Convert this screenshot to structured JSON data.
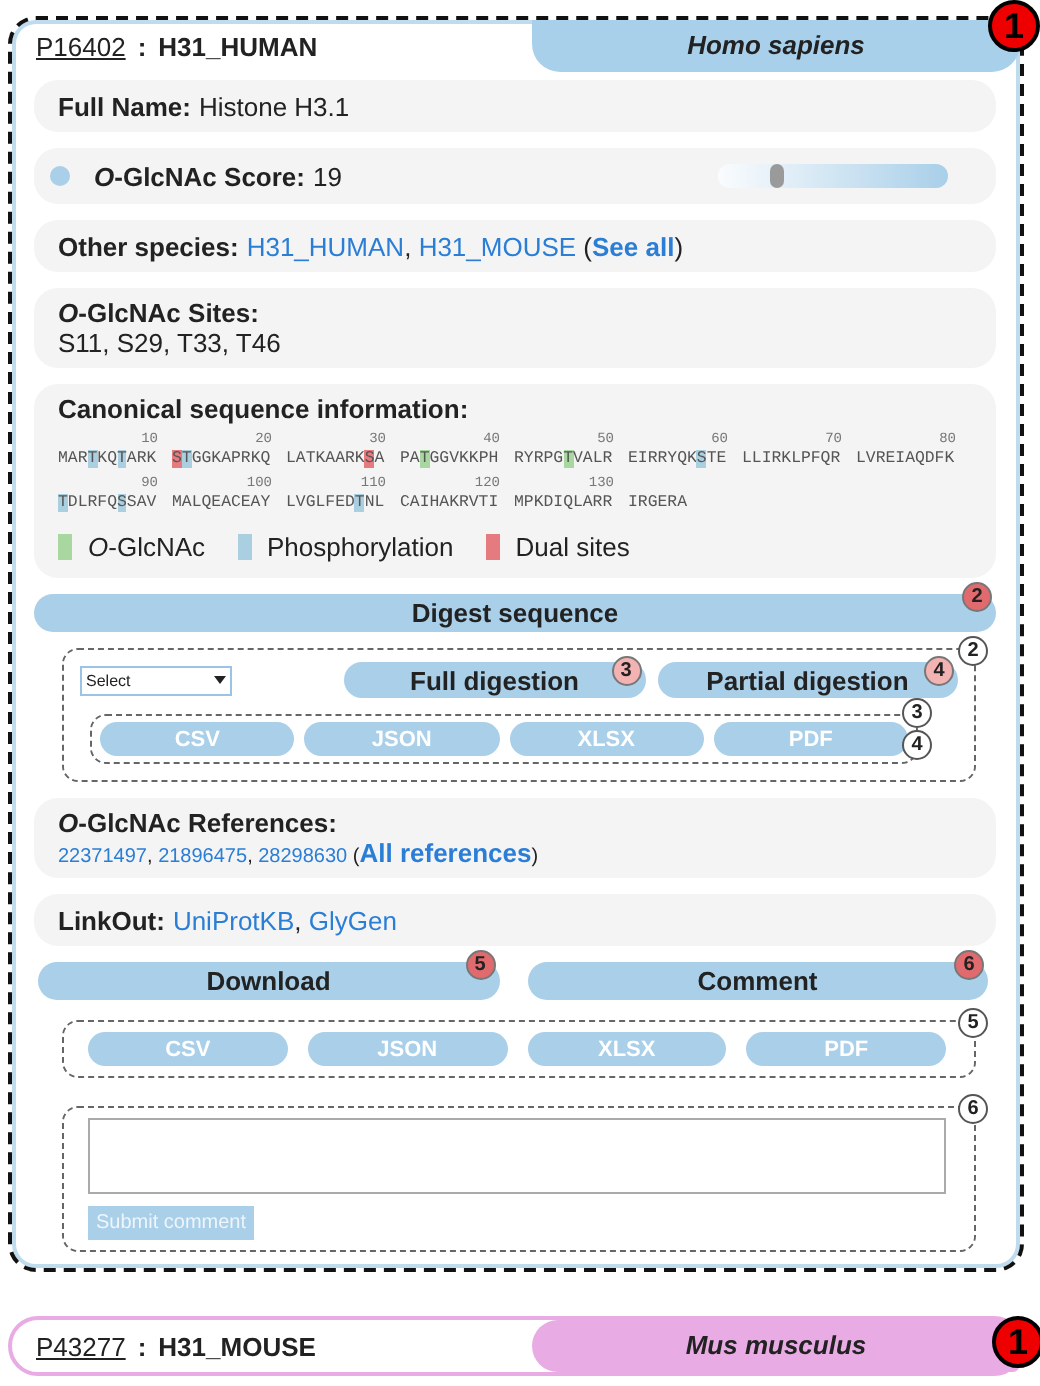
{
  "entries": [
    {
      "accession": "P16402",
      "name": "H31_HUMAN",
      "separator": ":",
      "species": "Homo sapiens",
      "color": "#a9d0ea",
      "badge": {
        "text": "1",
        "kind": "primary"
      },
      "expanded": true,
      "full_name": {
        "label": "Full Name:",
        "value": "Histone H3.1"
      },
      "score": {
        "label": "*O*-GlcNAc Score:",
        "value": "19",
        "level": 0.25
      },
      "other_species": {
        "label": "Other species:",
        "parts": [
          {
            "text": "H31_HUMAN",
            "kind": "link"
          },
          {
            "text": ", ",
            "kind": "plain"
          },
          {
            "text": "H31_MOUSE",
            "kind": "link"
          },
          {
            "text": " (",
            "kind": "plain"
          },
          {
            "text": "See all",
            "kind": "strong-link"
          },
          {
            "text": ")",
            "kind": "plain"
          }
        ]
      },
      "sites": {
        "label": "*O*-GlcNAc Sites:",
        "value": "S11, S29, T33, T46"
      },
      "sequence": {
        "title": "Canonical sequence information:",
        "lines": [
          [
            {
              "tick": "10",
              "segments": [
                {
                  "text": "MAR",
                  "kind": "plain"
                },
                {
                  "text": "T",
                  "kind": "phospho"
                },
                {
                  "text": "KQ",
                  "kind": "plain"
                },
                {
                  "text": "T",
                  "kind": "phospho"
                },
                {
                  "text": "ARK",
                  "kind": "plain"
                }
              ]
            },
            {
              "tick": "20",
              "segments": [
                {
                  "text": "S",
                  "kind": "dual"
                },
                {
                  "text": "T",
                  "kind": "phospho"
                },
                {
                  "text": "GGKAPRKQ",
                  "kind": "plain"
                }
              ]
            },
            {
              "tick": "30",
              "segments": [
                {
                  "text": "LATKAARK",
                  "kind": "plain"
                },
                {
                  "text": "S",
                  "kind": "dual"
                },
                {
                  "text": "A",
                  "kind": "plain"
                }
              ]
            },
            {
              "tick": "40",
              "segments": [
                {
                  "text": "PA",
                  "kind": "plain"
                },
                {
                  "text": "T",
                  "kind": "glcnac"
                },
                {
                  "text": "GGVKKPH",
                  "kind": "plain"
                }
              ]
            },
            {
              "tick": "50",
              "segments": [
                {
                  "text": "RYRPG",
                  "kind": "plain"
                },
                {
                  "text": "T",
                  "kind": "glcnac"
                },
                {
                  "text": "VALR",
                  "kind": "plain"
                }
              ]
            },
            {
              "tick": "60",
              "segments": [
                {
                  "text": "EIRRYQK",
                  "kind": "plain"
                },
                {
                  "text": "S",
                  "kind": "phospho"
                },
                {
                  "text": "TE",
                  "kind": "plain"
                }
              ]
            },
            {
              "tick": "70",
              "segments": [
                {
                  "text": "LLIRKLPFQR",
                  "kind": "plain"
                }
              ]
            },
            {
              "tick": "80",
              "segments": [
                {
                  "text": "LVREIAQDFK",
                  "kind": "plain"
                }
              ]
            }
          ],
          [
            {
              "tick": "90",
              "segments": [
                {
                  "text": "T",
                  "kind": "phospho"
                },
                {
                  "text": "DLRFQ",
                  "kind": "plain"
                },
                {
                  "text": "S",
                  "kind": "phospho"
                },
                {
                  "text": "SAV",
                  "kind": "plain"
                }
              ]
            },
            {
              "tick": "100",
              "segments": [
                {
                  "text": "MALQEACEAY",
                  "kind": "plain"
                }
              ]
            },
            {
              "tick": "110",
              "segments": [
                {
                  "text": "LVGLFED",
                  "kind": "plain"
                },
                {
                  "text": "T",
                  "kind": "phospho"
                },
                {
                  "text": "NL",
                  "kind": "plain"
                }
              ]
            },
            {
              "tick": "120",
              "segments": [
                {
                  "text": "CAIHAKRVTI",
                  "kind": "plain"
                }
              ]
            },
            {
              "tick": "130",
              "segments": [
                {
                  "text": "MPKDIQLARR",
                  "kind": "plain"
                }
              ]
            },
            {
              "segments": [
                {
                  "text": "IRGERA",
                  "kind": "plain"
                }
              ]
            }
          ]
        ],
        "legend": [
          {
            "label": "*O*-GlcNAc",
            "color": "#a8d8a0"
          },
          {
            "label": "Phosphorylation",
            "color": "#a9cfe0"
          },
          {
            "label": "Dual sites",
            "color": "#e57a7f"
          }
        ]
      },
      "digest": {
        "label": "Digest sequence",
        "badge": {
          "text": "2",
          "kind": "section"
        },
        "expanded": true,
        "panel_badge": {
          "text": "2",
          "kind": "panel"
        },
        "select": "Select",
        "actions": [
          {
            "label": "Full digestion",
            "badge": {
              "text": "3",
              "kind": "step"
            }
          },
          {
            "label": "Partial digestion",
            "badge": {
              "text": "4",
              "kind": "step"
            }
          }
        ],
        "format_badges": [
          {
            "text": "3",
            "kind": "panel"
          },
          {
            "text": "4",
            "kind": "panel"
          }
        ],
        "formats": [
          "CSV",
          "JSON",
          "XLSX",
          "PDF"
        ]
      },
      "references": {
        "label": "*O*-GlcNAc References:",
        "parts": [
          {
            "text": "22371497",
            "kind": "link"
          },
          {
            "text": ", ",
            "kind": "plain"
          },
          {
            "text": "21896475",
            "kind": "link"
          },
          {
            "text": ", ",
            "kind": "plain"
          },
          {
            "text": "28298630",
            "kind": "link"
          },
          {
            "text": " (",
            "kind": "plain"
          },
          {
            "text": "All references",
            "kind": "strong-link"
          },
          {
            "text": ")",
            "kind": "plain"
          }
        ]
      },
      "linkout": {
        "label": "LinkOut:",
        "parts": [
          {
            "text": "UniProtKB",
            "kind": "link"
          },
          {
            "text": ", ",
            "kind": "plain"
          },
          {
            "text": "GlyGen",
            "kind": "link"
          }
        ]
      },
      "download": {
        "label": "Download",
        "badge": {
          "text": "5",
          "kind": "section"
        },
        "expanded": true,
        "panel_badge": {
          "text": "5",
          "kind": "panel"
        },
        "formats": [
          "CSV",
          "JSON",
          "XLSX",
          "PDF"
        ]
      },
      "comment": {
        "label": "Comment",
        "badge": {
          "text": "6",
          "kind": "section"
        },
        "expanded": true,
        "panel_badge": {
          "text": "6",
          "kind": "panel"
        },
        "submit": "Submit comment",
        "submit_disabled": true
      }
    },
    {
      "accession": "P43277",
      "name": "H31_MOUSE",
      "separator": ":",
      "species": "Mus musculus",
      "color": "#e8abe4",
      "badge": {
        "text": "1",
        "kind": "primary"
      },
      "expanded": false
    }
  ]
}
